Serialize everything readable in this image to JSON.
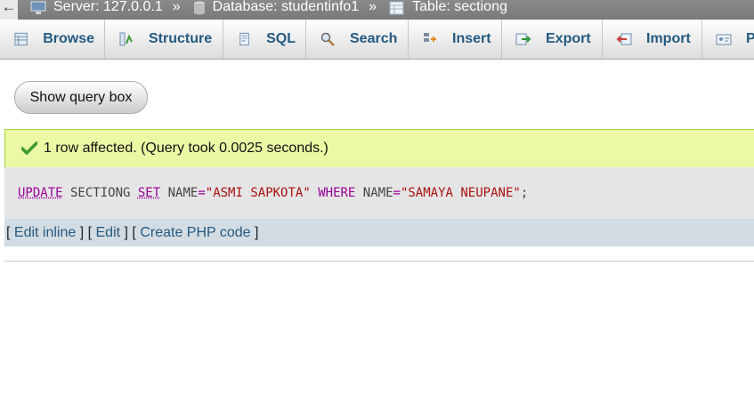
{
  "breadcrumb": {
    "back": "←",
    "server": "Server: 127.0.0.1",
    "database": "Database: studentinfo1",
    "table": "Table: sectiong",
    "separator": "»"
  },
  "tabs": [
    {
      "label": "Browse",
      "icon": "browse-icon"
    },
    {
      "label": "Structure",
      "icon": "structure-icon"
    },
    {
      "label": "SQL",
      "icon": "sql-icon"
    },
    {
      "label": "Search",
      "icon": "search-icon"
    },
    {
      "label": "Insert",
      "icon": "insert-icon"
    },
    {
      "label": "Export",
      "icon": "export-icon"
    },
    {
      "label": "Import",
      "icon": "import-icon"
    },
    {
      "label": "Pr",
      "icon": "privileges-icon"
    }
  ],
  "show_query_label": "Show query box",
  "result": {
    "message": "1 row affected. (Query took 0.0025 seconds.)",
    "sql": {
      "kw_update": "UPDATE",
      "table": " SECTIONG ",
      "kw_set": "SET",
      "col1": " NAME",
      "eq1": "=",
      "val1": "\"ASMI SAPKOTA\"",
      "kw_where": " WHERE",
      "col2": " NAME",
      "eq2": "=",
      "val2": "\"SAMAYA NEUPANE\"",
      "end": ";"
    },
    "links": {
      "open1": "[ ",
      "edit_inline": "Edit inline",
      "mid1": " ] [ ",
      "edit": "Edit",
      "mid2": " ] [ ",
      "create_php": "Create PHP code",
      "close": " ]"
    }
  },
  "colors": {
    "success_bg": "#ebf8a4",
    "link": "#235a81",
    "keyword": "#990099",
    "string": "#aa1111"
  }
}
